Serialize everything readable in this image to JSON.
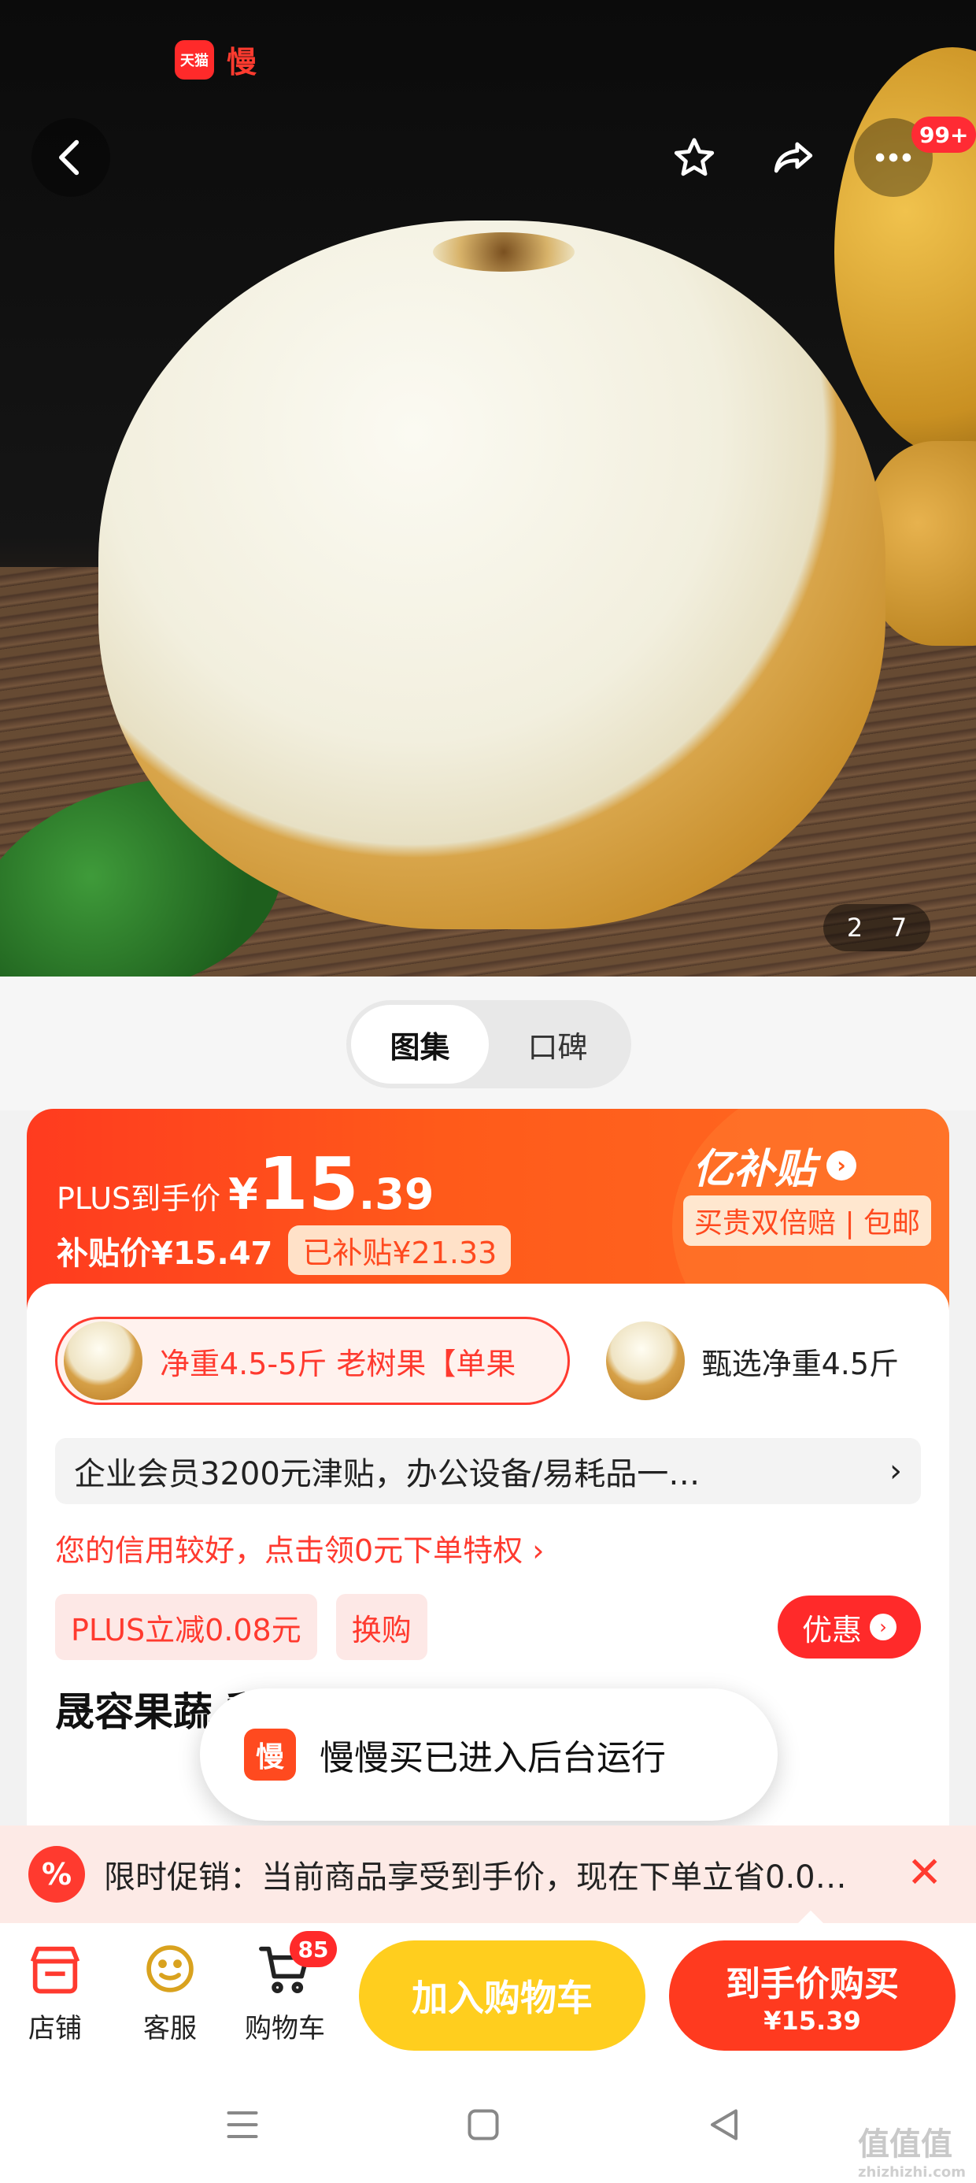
{
  "header": {
    "brand_tmall": "天猫",
    "brand_app": "慢",
    "more_badge": "99+"
  },
  "gallery": {
    "pager_current": "2",
    "pager_total": "7",
    "tabs": [
      {
        "label": "图集",
        "active": true
      },
      {
        "label": "口碑",
        "active": false
      }
    ]
  },
  "price": {
    "plus_label": "PLUS到手价",
    "plus_currency": "¥",
    "plus_int": "15",
    "plus_dec": ".39",
    "subsidy_label": "补贴价¥15.47",
    "subsidy_tag": "已补贴¥21.33",
    "yi_title": "亿补贴",
    "yi_sub": "买贵双倍赔 | 包邮"
  },
  "skus": [
    {
      "label": "净重4.5-5斤 老树果【单果",
      "active": true
    },
    {
      "label": "甄选净重4.5斤",
      "active": false
    }
  ],
  "enterprise": {
    "text": "企业会员3200元津贴，办公设备/易耗品一…",
    "arrow": "›"
  },
  "credit": "您的信用较好，点击领0元下单特权 ›",
  "promo_tags": [
    "PLUS立减0.08元",
    "换购"
  ],
  "youhui": "优惠",
  "product_title": "晟容果蔬                                          梨 超大梨子新鲜水",
  "toast": {
    "icon_text": "慢",
    "message": "慢慢买已进入后台运行"
  },
  "promo_strip": {
    "icon": "%",
    "text": "限时促销：当前商品享受到手价，现在下单立省0.0…",
    "close": "✕"
  },
  "actions": {
    "store": "店铺",
    "service": "客服",
    "cart": "购物车",
    "cart_count": "85",
    "add_cart": "加入购物车",
    "buy_main": "到手价购买",
    "buy_sub": "¥15.39"
  },
  "watermark": {
    "text": "值值值",
    "sub": "zhizhizhi.com"
  },
  "colors": {
    "accent": "#ff3a1f",
    "cart_button": "#ffce1e"
  }
}
